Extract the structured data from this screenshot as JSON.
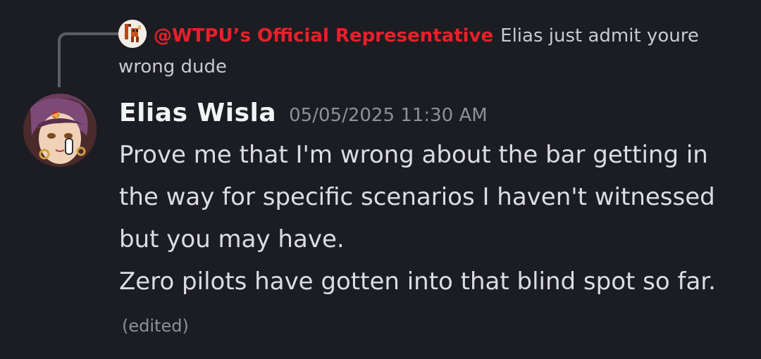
{
  "reply": {
    "author": "@WTPU’s Official Representative",
    "text": "Elias just admit youre wrong dude",
    "author_color": "#e8202a"
  },
  "message": {
    "username": "Elias Wisla",
    "timestamp": "05/05/2025 11:30 AM",
    "line1": "Prove me that I'm wrong about the bar getting in the way for specific scenarios I haven't witnessed but you may have.",
    "line2": "Zero pilots have gotten into that blind spot so far.",
    "edited_label": "(edited)"
  },
  "icons": {
    "reply_avatar": "pixel-character-avatar",
    "author_avatar": "anime-character-avatar"
  }
}
